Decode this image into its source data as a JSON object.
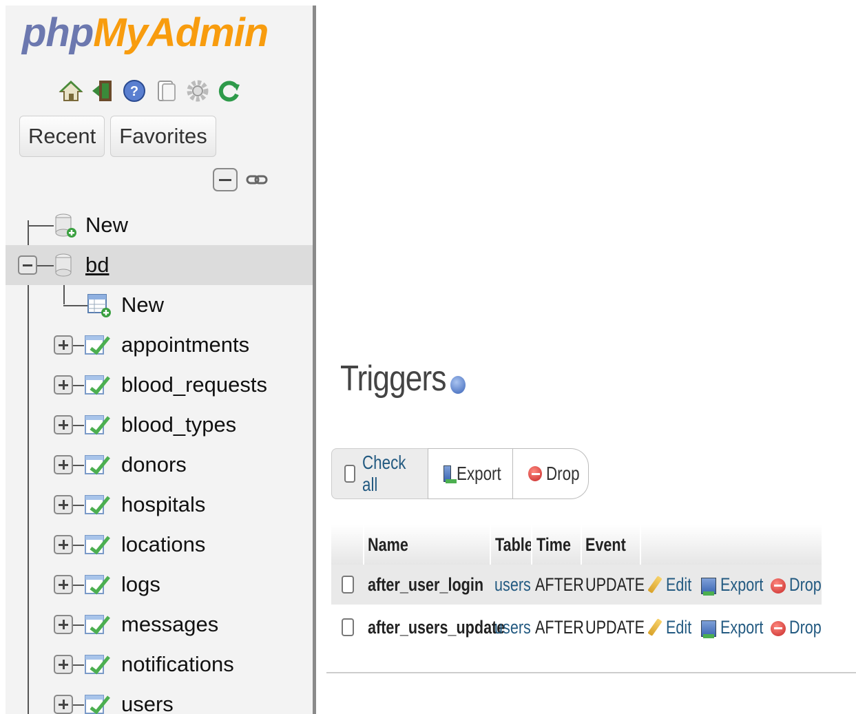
{
  "sidebar": {
    "logo_php": "php",
    "logo_my": "MyAdmin",
    "logo_icons": [
      "home-icon",
      "exit-icon",
      "help-icon",
      "docs-icon",
      "settings-icon",
      "reload-icon"
    ],
    "recent_label": "Recent",
    "favorites_label": "Favorites",
    "tree": {
      "new_db_label": "New",
      "database": "bd",
      "new_table_label": "New",
      "tables": [
        "appointments",
        "blood_requests",
        "blood_types",
        "donors",
        "hospitals",
        "locations",
        "logs",
        "messages",
        "notifications",
        "users"
      ]
    }
  },
  "main": {
    "title": "Triggers",
    "bulk": {
      "check_all": "Check all",
      "export": "Export",
      "drop": "Drop"
    },
    "table": {
      "headers": [
        "Name",
        "Table",
        "Time",
        "Event"
      ],
      "rows": [
        {
          "name": "after_user_login",
          "table": "users",
          "time": "AFTER",
          "event": "UPDATE",
          "edit": "Edit",
          "export": "Export",
          "drop": "Drop"
        },
        {
          "name": "after_users_update",
          "table": "users",
          "time": "AFTER",
          "event": "UPDATE",
          "edit": "Edit",
          "export": "Export",
          "drop": "Drop"
        }
      ]
    }
  },
  "colors": {
    "logo_php": "#6c78af",
    "logo_my": "#f89c0e",
    "link": "#235a81",
    "sidebar_bg": "#f3f3f3",
    "selected_row": "#dcdcdc"
  }
}
